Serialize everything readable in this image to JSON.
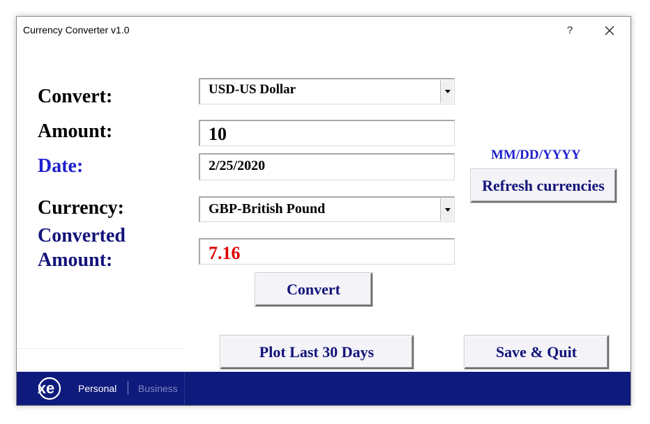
{
  "window": {
    "title": "Currency Converter v1.0",
    "help_label": "?",
    "close_icon": "close-icon"
  },
  "labels": {
    "convert": "Convert:",
    "amount": "Amount:",
    "date": "Date:",
    "currency": "Currency:",
    "converted_line1": "Converted",
    "converted_line2": "Amount:"
  },
  "fields": {
    "from_currency": "USD-US Dollar",
    "amount": "10",
    "date": "2/25/2020",
    "to_currency": "GBP-British Pound",
    "converted_amount": "7.16"
  },
  "date_format_hint": "MM/DD/YYYY",
  "buttons": {
    "refresh": "Refresh currencies",
    "convert": "Convert",
    "plot": "Plot Last 30 Days",
    "save_quit": "Save & Quit"
  },
  "footer": {
    "logo_text": "xe",
    "personal": "Personal",
    "business": "Business"
  },
  "colors": {
    "label_blue": "#1f1fcf",
    "label_navy": "#13137a",
    "converted_value": "#e00000",
    "footer_bg": "#0f1b7c"
  }
}
